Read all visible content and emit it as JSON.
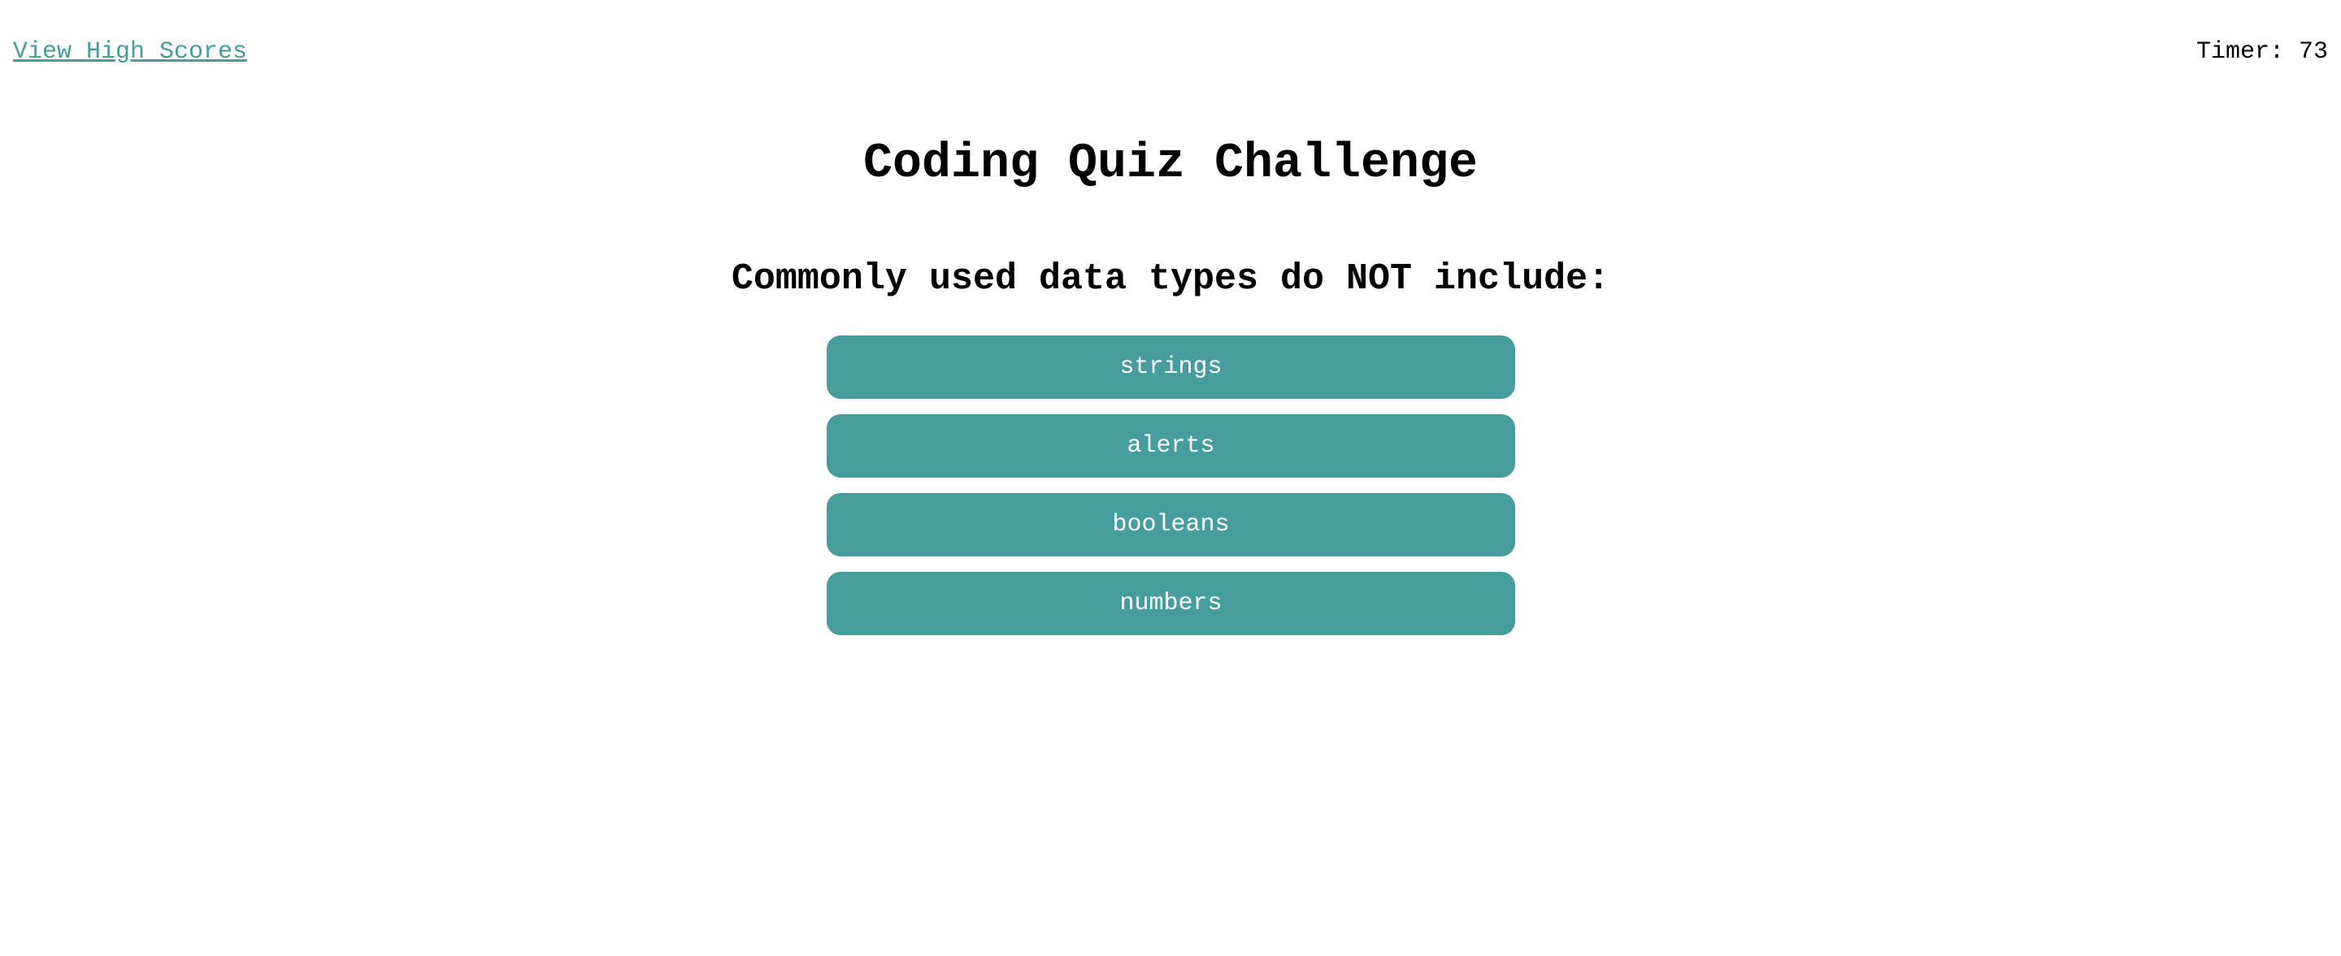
{
  "header": {
    "high_scores_link": "View High Scores",
    "timer_label": "Timer:",
    "timer_value": "73"
  },
  "main": {
    "title": "Coding Quiz Challenge",
    "question": "Commonly used data types do NOT include:",
    "choices": [
      {
        "label": "strings"
      },
      {
        "label": "alerts"
      },
      {
        "label": "booleans"
      },
      {
        "label": "numbers"
      }
    ]
  },
  "colors": {
    "accent": "#459d9c",
    "button_text": "#ffffff",
    "text": "#000000",
    "background": "#ffffff"
  }
}
